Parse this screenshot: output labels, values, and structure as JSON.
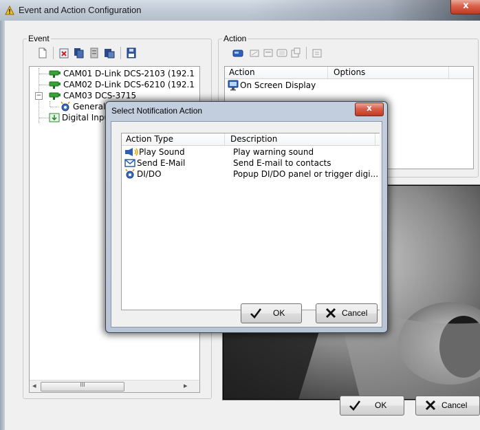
{
  "window": {
    "title": "Event and Action Configuration",
    "close_glyph": "x"
  },
  "event_group": {
    "label": "Event",
    "toolbar": [
      "new-icon",
      "delete-icon",
      "copy-icon",
      "properties-icon",
      "paste-icon",
      "save-icon"
    ],
    "tree": [
      {
        "text": "CAM01 D-Link DCS-2103 (192.1",
        "icon": "camera-icon"
      },
      {
        "text": "CAM02 D-Link DCS-6210 (192.1",
        "icon": "camera-icon"
      },
      {
        "text": "CAM03 DCS-3715",
        "icon": "camera-icon",
        "expander": "−"
      },
      {
        "text": "General",
        "icon": "event-icon"
      },
      {
        "text": "Digital Input",
        "icon": "digital-input-icon"
      }
    ],
    "scrollbar": {
      "left_arrow": "◂",
      "right_arrow": "▸",
      "grip": "III"
    }
  },
  "action_group": {
    "label": "Action",
    "toolbar": [
      "add-action-icon",
      "edit-action-icon",
      "delete-action-icon",
      "copy-action-icon",
      "paste-action-icon",
      "test-action-icon"
    ],
    "columns": {
      "action": "Action",
      "options": "Options"
    },
    "rows": [
      {
        "action": "On Screen Display",
        "options": ""
      }
    ]
  },
  "footer": {
    "ok": "OK",
    "cancel": "Cancel"
  },
  "dialog": {
    "title": "Select Notification Action",
    "close_glyph": "x",
    "columns": {
      "type": "Action Type",
      "description": "Description"
    },
    "rows": [
      {
        "type": "Play Sound",
        "description": "Play warning sound",
        "icon": "speaker-icon"
      },
      {
        "type": "Send E-Mail",
        "description": "Send E-mail to contacts",
        "icon": "email-icon"
      },
      {
        "type": "DI/DO",
        "description": "Popup DI/DO panel or trigger digi...",
        "icon": "alarm-icon"
      }
    ],
    "ok": "OK",
    "cancel": "Cancel"
  }
}
